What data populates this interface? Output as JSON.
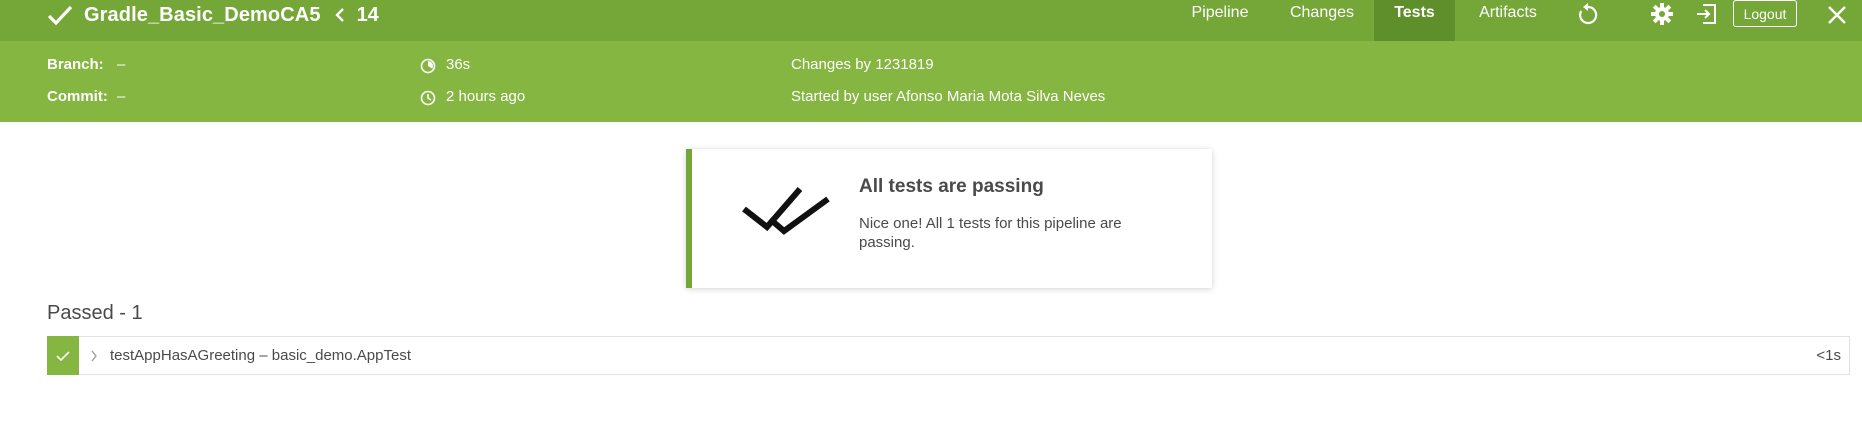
{
  "header": {
    "pipeline_name": "Gradle_Basic_DemoCA5",
    "run_number": "14",
    "tabs": [
      {
        "label": "Pipeline",
        "active": false
      },
      {
        "label": "Changes",
        "active": false
      },
      {
        "label": "Tests",
        "active": true
      },
      {
        "label": "Artifacts",
        "active": false
      }
    ],
    "logout_label": "Logout",
    "icons": [
      "check-icon",
      "chevron-left-icon",
      "replay-icon",
      "gear-icon",
      "exit-icon",
      "close-icon"
    ]
  },
  "run_details": {
    "branch_label": "Branch:",
    "branch_value": "–",
    "commit_label": "Commit:",
    "commit_value": "–",
    "duration": "36s",
    "started_ago": "2 hours ago",
    "changes": "Changes by 1231819",
    "started_by": "Started by user Afonso Maria Mota Silva Neves"
  },
  "result": {
    "title": "All tests are passing",
    "message": "Nice one! All 1 tests for this pipeline are passing."
  },
  "passed": {
    "heading": "Passed - 1",
    "tests": [
      {
        "name": "testAppHasAGreeting – basic_demo.AppTest",
        "duration": "<1s",
        "status": "passed"
      }
    ]
  },
  "colors": {
    "header_green": "#75a738",
    "detail_green": "#84b641",
    "active_tab": "#5f8f2b",
    "text": "#4a4a4a"
  }
}
